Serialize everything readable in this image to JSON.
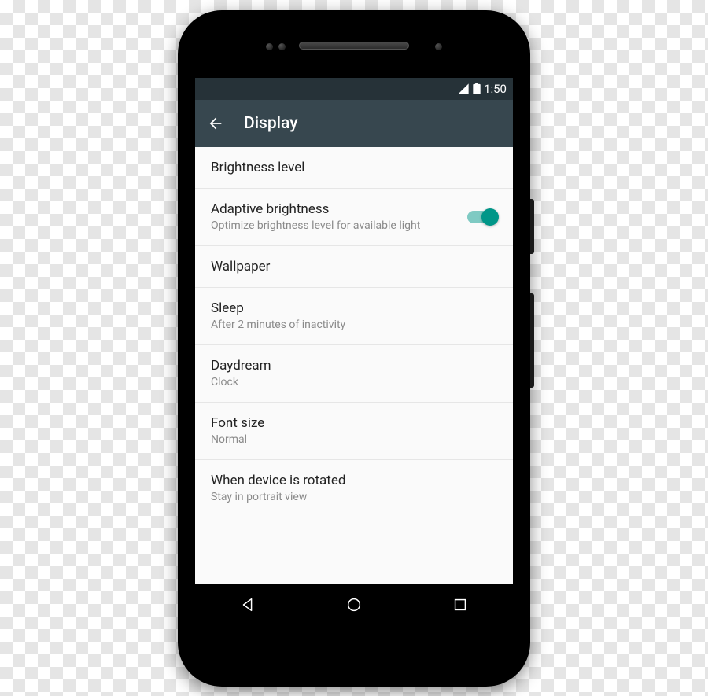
{
  "status_bar": {
    "time": "1:50"
  },
  "app_bar": {
    "title": "Display"
  },
  "settings": {
    "brightness": {
      "title": "Brightness level"
    },
    "adaptive": {
      "title": "Adaptive brightness",
      "subtitle": "Optimize brightness level for available light",
      "toggle_on": true
    },
    "wallpaper": {
      "title": "Wallpaper"
    },
    "sleep": {
      "title": "Sleep",
      "subtitle": "After 2 minutes of inactivity"
    },
    "daydream": {
      "title": "Daydream",
      "subtitle": "Clock"
    },
    "font_size": {
      "title": "Font size",
      "subtitle": "Normal"
    },
    "rotation": {
      "title": "When device is rotated",
      "subtitle": "Stay in portrait view"
    }
  }
}
